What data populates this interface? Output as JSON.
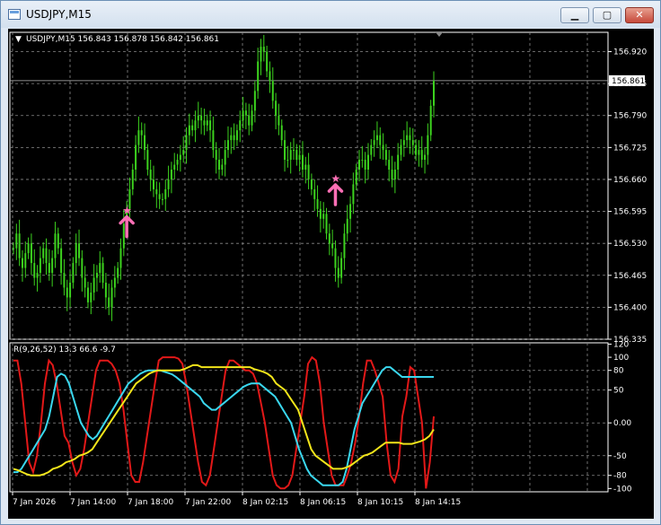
{
  "window": {
    "title": "USDJPY,M15",
    "minimize_icon": "minimize-icon",
    "maximize_icon": "maximize-icon",
    "close_icon": "close-icon"
  },
  "colors": {
    "background": "#000000",
    "candles": "#3cd21e",
    "grid": "#8a8a8a",
    "text": "#ffffff",
    "arrows": "#ff6fb5",
    "ind_red": "#e21818",
    "ind_cyan": "#3ad7ee",
    "ind_yellow": "#f2e51a"
  },
  "main_chart": {
    "header": "USDJPY,M15  156.843 156.878 156.842 156.861",
    "price_ticks": [
      "156.920",
      "156.855",
      "156.790",
      "156.725",
      "156.660",
      "156.595",
      "156.530",
      "156.465",
      "156.400",
      "156.335"
    ],
    "current_price": "156.861"
  },
  "indicator": {
    "header": "R(9,26,52) 13.3 66.6 -9.7",
    "scale_labels": [
      "120",
      "100",
      "80",
      "50",
      "0.00",
      "-50",
      "-80",
      "-100"
    ]
  },
  "time_axis": [
    "7 Jan 2026",
    "7 Jan 14:00",
    "7 Jan 18:00",
    "7 Jan 22:00",
    "8 Jan 02:15",
    "8 Jan 06:15",
    "8 Jan 10:15",
    "8 Jan 14:15"
  ],
  "chart_data": {
    "type": "candlestick",
    "symbol": "USDJPY",
    "timeframe": "M15",
    "ohlc_last": {
      "open": 156.843,
      "high": 156.878,
      "low": 156.842,
      "close": 156.861
    },
    "y_range": [
      156.335,
      156.952
    ],
    "closes": [
      156.52,
      156.55,
      156.5,
      156.48,
      156.51,
      156.53,
      156.49,
      156.46,
      156.47,
      156.5,
      156.52,
      156.49,
      156.47,
      156.5,
      156.55,
      156.52,
      156.47,
      156.44,
      156.42,
      156.45,
      156.49,
      156.53,
      156.5,
      156.46,
      156.44,
      156.41,
      156.43,
      156.46,
      156.47,
      156.49,
      156.45,
      156.42,
      156.4,
      156.44,
      156.46,
      156.48,
      156.52,
      156.57,
      156.6,
      156.64,
      156.68,
      156.73,
      156.76,
      156.75,
      156.72,
      156.68,
      156.66,
      156.64,
      156.63,
      156.62,
      156.62,
      156.64,
      156.66,
      156.68,
      156.69,
      156.7,
      156.71,
      156.72,
      156.75,
      156.77,
      156.76,
      156.78,
      156.79,
      156.78,
      156.77,
      156.78,
      156.76,
      156.72,
      156.7,
      156.68,
      156.69,
      156.72,
      156.74,
      156.75,
      156.74,
      156.76,
      156.78,
      156.8,
      156.79,
      156.77,
      156.8,
      156.84,
      156.9,
      156.93,
      156.92,
      156.88,
      156.86,
      156.82,
      156.79,
      156.77,
      156.74,
      156.7,
      156.7,
      156.72,
      156.72,
      156.7,
      156.71,
      156.68,
      156.69,
      156.66,
      156.64,
      156.62,
      156.6,
      156.58,
      156.59,
      156.55,
      156.53,
      156.52,
      156.48,
      156.46,
      156.5,
      156.55,
      156.58,
      156.61,
      156.65,
      156.68,
      156.7,
      156.7,
      156.68,
      156.71,
      156.73,
      156.74,
      156.75,
      156.73,
      156.72,
      156.7,
      156.68,
      156.66,
      156.68,
      156.71,
      156.73,
      156.74,
      156.75,
      156.74,
      156.73,
      156.71,
      156.72,
      156.7,
      156.71,
      156.75,
      156.81,
      156.86
    ],
    "signals": [
      {
        "type": "buy",
        "index": 38,
        "price": 156.595
      },
      {
        "type": "buy",
        "index": 108,
        "price": 156.66
      }
    ],
    "indicator": {
      "name": "R(9,26,52)",
      "values": [
        13.3,
        66.6,
        -9.7
      ],
      "ylim": [
        -100,
        120
      ],
      "series": [
        {
          "color": "red",
          "values": [
            95,
            95,
            60,
            0,
            -60,
            -75,
            -50,
            0,
            60,
            95,
            88,
            60,
            20,
            -20,
            -30,
            -60,
            -80,
            -70,
            -40,
            0,
            40,
            80,
            95,
            95,
            95,
            90,
            80,
            60,
            20,
            -30,
            -80,
            -90,
            -90,
            -60,
            -20,
            20,
            60,
            95,
            100,
            100,
            100,
            100,
            98,
            90,
            60,
            20,
            -20,
            -60,
            -90,
            -95,
            -80,
            -40,
            0,
            40,
            80,
            95,
            95,
            90,
            85,
            80,
            80,
            75,
            60,
            30,
            0,
            -40,
            -80,
            -95,
            -100,
            -100,
            -95,
            -80,
            -40,
            0,
            40,
            90,
            100,
            95,
            60,
            0,
            -40,
            -80,
            -95,
            -95,
            -95,
            -80,
            -60,
            -30,
            10,
            60,
            95,
            95,
            80,
            60,
            40,
            -30,
            -80,
            -90,
            -70,
            10,
            40,
            85,
            80,
            40,
            0,
            -100,
            -60,
            10
          ]
        },
        {
          "color": "cyan",
          "values": [
            -75,
            -75,
            -70,
            -60,
            -50,
            -40,
            -30,
            -20,
            -10,
            10,
            40,
            70,
            75,
            72,
            60,
            40,
            20,
            0,
            -10,
            -20,
            -25,
            -20,
            -10,
            0,
            10,
            20,
            30,
            40,
            50,
            60,
            65,
            70,
            75,
            78,
            80,
            80,
            80,
            80,
            78,
            76,
            74,
            70,
            65,
            60,
            55,
            50,
            45,
            40,
            30,
            25,
            20,
            20,
            25,
            30,
            35,
            40,
            45,
            50,
            55,
            58,
            60,
            60,
            60,
            55,
            50,
            45,
            40,
            30,
            20,
            10,
            0,
            -20,
            -40,
            -55,
            -70,
            -80,
            -85,
            -90,
            -95,
            -95,
            -95,
            -95,
            -95,
            -90,
            -70,
            -40,
            -10,
            10,
            30,
            40,
            50,
            60,
            70,
            80,
            85,
            85,
            80,
            75,
            70,
            70,
            70,
            70,
            70,
            70,
            70,
            70,
            70
          ]
        },
        {
          "color": "yellow",
          "values": [
            -70,
            -72,
            -75,
            -78,
            -80,
            -80,
            -80,
            -78,
            -75,
            -70,
            -68,
            -65,
            -60,
            -58,
            -55,
            -50,
            -48,
            -45,
            -40,
            -30,
            -20,
            -10,
            0,
            10,
            20,
            30,
            40,
            50,
            60,
            65,
            70,
            75,
            78,
            80,
            80,
            80,
            80,
            80,
            80,
            82,
            85,
            88,
            88,
            85,
            85,
            85,
            85,
            85,
            85,
            85,
            85,
            85,
            85,
            85,
            85,
            82,
            80,
            78,
            75,
            70,
            60,
            55,
            50,
            40,
            30,
            20,
            0,
            -20,
            -40,
            -50,
            -55,
            -60,
            -65,
            -70,
            -70,
            -70,
            -68,
            -65,
            -60,
            -55,
            -50,
            -48,
            -45,
            -40,
            -35,
            -30,
            -30,
            -30,
            -30,
            -32,
            -32,
            -32,
            -30,
            -28,
            -25,
            -20,
            -10
          ]
        }
      ]
    }
  }
}
